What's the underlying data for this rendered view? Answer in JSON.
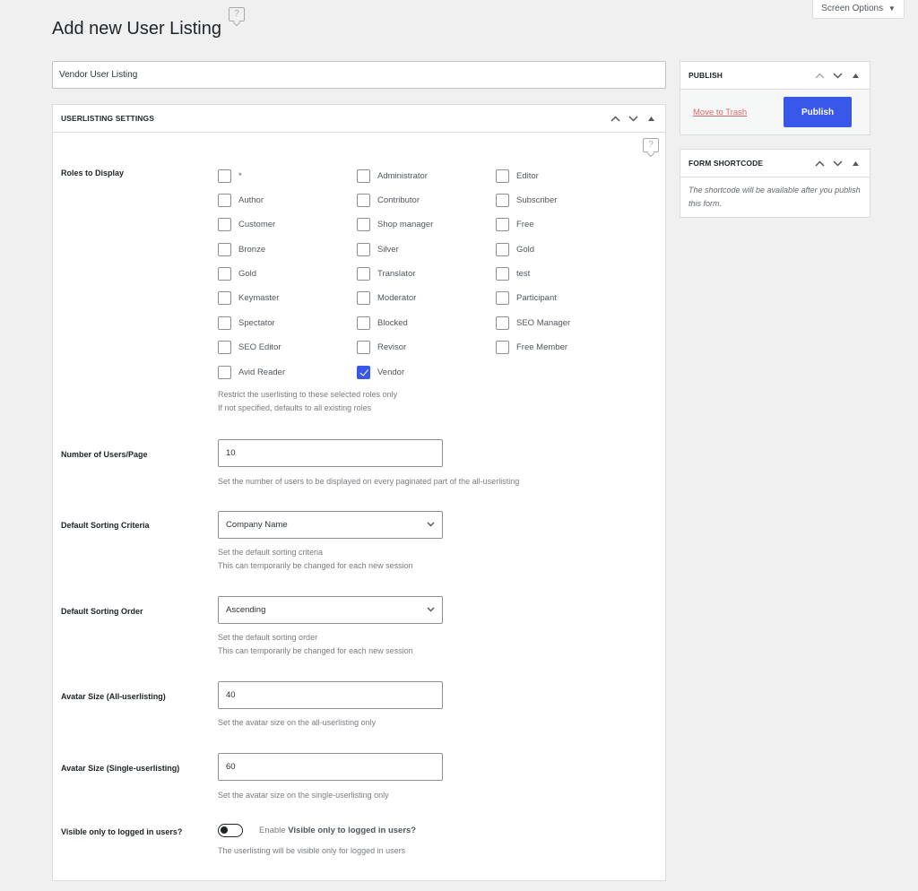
{
  "header": {
    "title": "Add new User Listing",
    "help_icon": "help-bubble-icon",
    "screen_options_label": "Screen Options",
    "screen_options_icon": "triangle-down-icon"
  },
  "title_input": {
    "value": "Vendor User Listing"
  },
  "settings_box": {
    "title": "USERLISTING SETTINGS",
    "roles": {
      "label": "Roles to Display",
      "items": [
        {
          "label": "*",
          "checked": false
        },
        {
          "label": "Administrator",
          "checked": false
        },
        {
          "label": "Editor",
          "checked": false
        },
        {
          "label": "Author",
          "checked": false
        },
        {
          "label": "Contributor",
          "checked": false
        },
        {
          "label": "Subscriber",
          "checked": false
        },
        {
          "label": "Customer",
          "checked": false
        },
        {
          "label": "Shop manager",
          "checked": false
        },
        {
          "label": "Free",
          "checked": false
        },
        {
          "label": "Bronze",
          "checked": false
        },
        {
          "label": "Silver",
          "checked": false
        },
        {
          "label": "Gold",
          "checked": false
        },
        {
          "label": "Gold",
          "checked": false
        },
        {
          "label": "Translator",
          "checked": false
        },
        {
          "label": "test",
          "checked": false
        },
        {
          "label": "Keymaster",
          "checked": false
        },
        {
          "label": "Moderator",
          "checked": false
        },
        {
          "label": "Participant",
          "checked": false
        },
        {
          "label": "Spectator",
          "checked": false
        },
        {
          "label": "Blocked",
          "checked": false
        },
        {
          "label": "SEO Manager",
          "checked": false
        },
        {
          "label": "SEO Editor",
          "checked": false
        },
        {
          "label": "Revisor",
          "checked": false
        },
        {
          "label": "Free Member",
          "checked": false
        },
        {
          "label": "Avid Reader",
          "checked": false
        },
        {
          "label": "Vendor",
          "checked": true
        }
      ],
      "desc_1": "Restrict the userlisting to these selected roles only",
      "desc_2": "If not specified, defaults to all existing roles"
    },
    "users_per_page": {
      "label": "Number of Users/Page",
      "value": "10",
      "desc": "Set the number of users to be displayed on every paginated part of the all-userlisting"
    },
    "sorting_criteria": {
      "label": "Default Sorting Criteria",
      "value": "Company Name",
      "desc_1": "Set the default sorting criteria",
      "desc_2": "This can temporarily be changed for each new session"
    },
    "sorting_order": {
      "label": "Default Sorting Order",
      "value": "Ascending",
      "desc_1": "Set the default sorting order",
      "desc_2": "This can temporarily be changed for each new session"
    },
    "avatar_all": {
      "label": "Avatar Size (All-userlisting)",
      "value": "40",
      "desc": "Set the avatar size on the all-userlisting only"
    },
    "avatar_single": {
      "label": "Avatar Size (Single-userlisting)",
      "value": "60",
      "desc": "Set the avatar size on the single-userlisting only"
    },
    "visible_logged_in": {
      "label": "Visible only to logged in users?",
      "enabled": false,
      "toggle_prefix": "Enable",
      "toggle_bold": "Visible only to logged in users?",
      "desc": "The userlisting will be visible only for logged in users"
    }
  },
  "publish_box": {
    "title": "PUBLISH",
    "trash_label": "Move to Trash",
    "publish_label": "Publish",
    "accent": "#3858e9"
  },
  "shortcode_box": {
    "title": "FORM SHORTCODE",
    "message": "The shortcode will be available after you publish this form."
  }
}
